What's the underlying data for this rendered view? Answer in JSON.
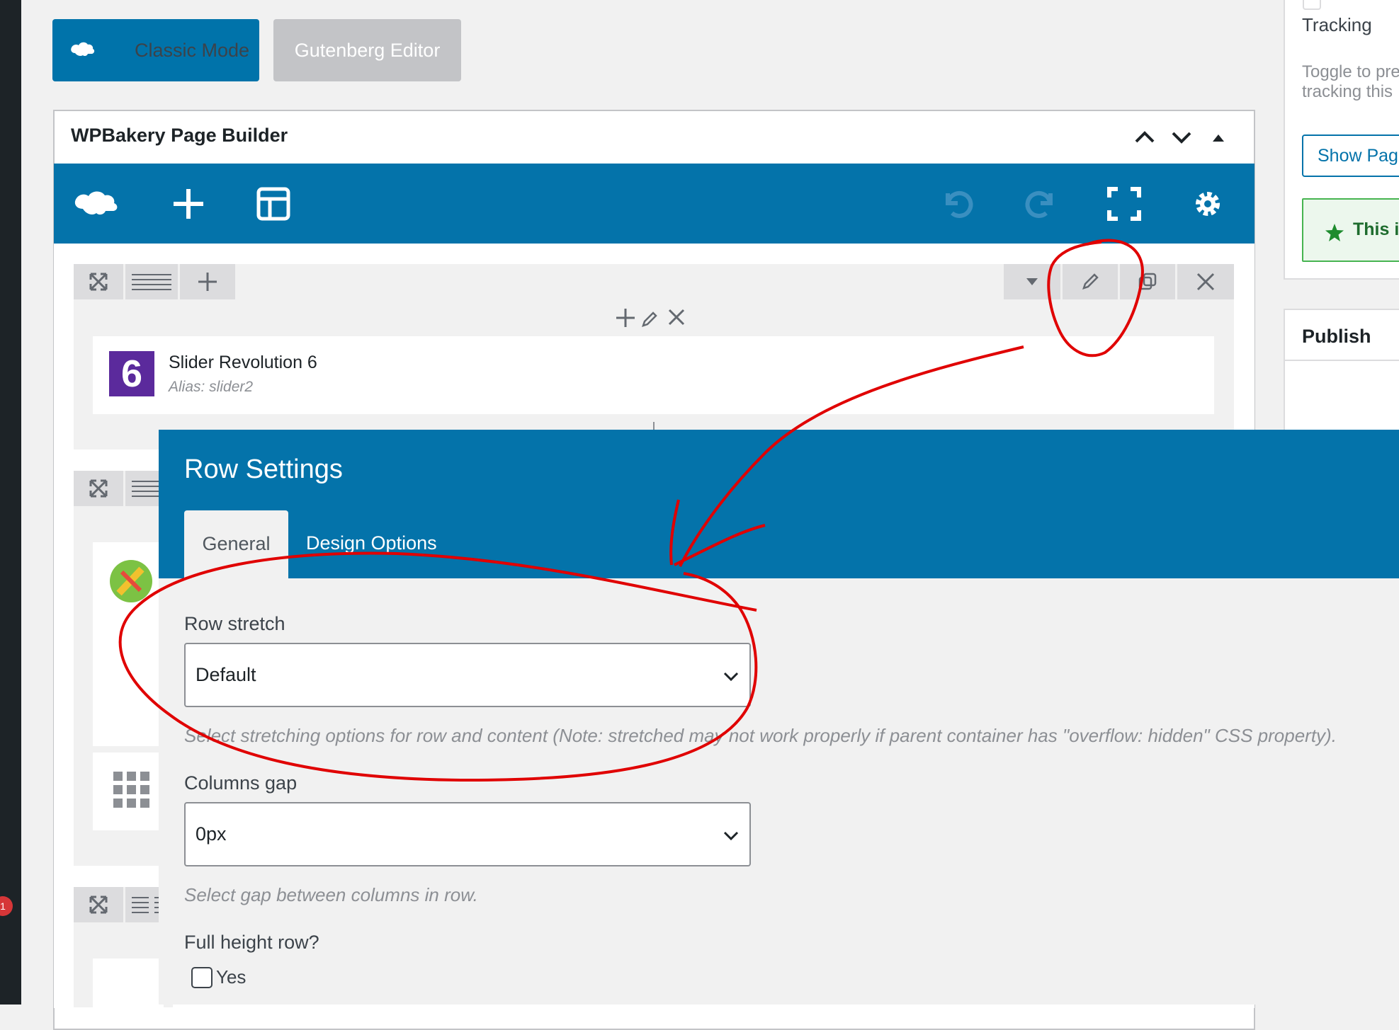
{
  "editor_modes": {
    "classic_label": "Classic Mode",
    "gutenberg_label": "Gutenberg Editor"
  },
  "wpbakery": {
    "title": "WPBakery Page Builder",
    "toolbar_icons": [
      "wpbakery-logo-icon",
      "add-icon",
      "templates-icon",
      "undo-icon",
      "redo-icon",
      "fullscreen-icon",
      "settings-icon"
    ]
  },
  "rows": {
    "slider_element": {
      "title": "Slider Revolution 6",
      "alias": "Alias: slider2",
      "logo_text": "6"
    }
  },
  "row_settings": {
    "title": "Row Settings",
    "tabs": [
      {
        "label": "General",
        "active": true
      },
      {
        "label": "Design Options",
        "active": false
      }
    ],
    "row_stretch": {
      "label": "Row stretch",
      "value": "Default",
      "help": "Select stretching options for row and content (Note: stretched may not work properly if parent container has \"overflow: hidden\" CSS property)."
    },
    "columns_gap": {
      "label": "Columns gap",
      "value": "0px",
      "help": "Select gap between columns in row."
    },
    "full_height": {
      "label": "Full height row?",
      "option": "Yes",
      "checked": false
    }
  },
  "right_sidebar": {
    "tracking_label": "Tracking",
    "toggle_text_1": "Toggle to pre",
    "toggle_text_2": "tracking this",
    "show_page_button": "Show Page",
    "notice_text": "This is",
    "publish_title": "Publish"
  },
  "notification_count": "1",
  "colors": {
    "accent": "#0473aa",
    "annotation": "#e00000"
  }
}
